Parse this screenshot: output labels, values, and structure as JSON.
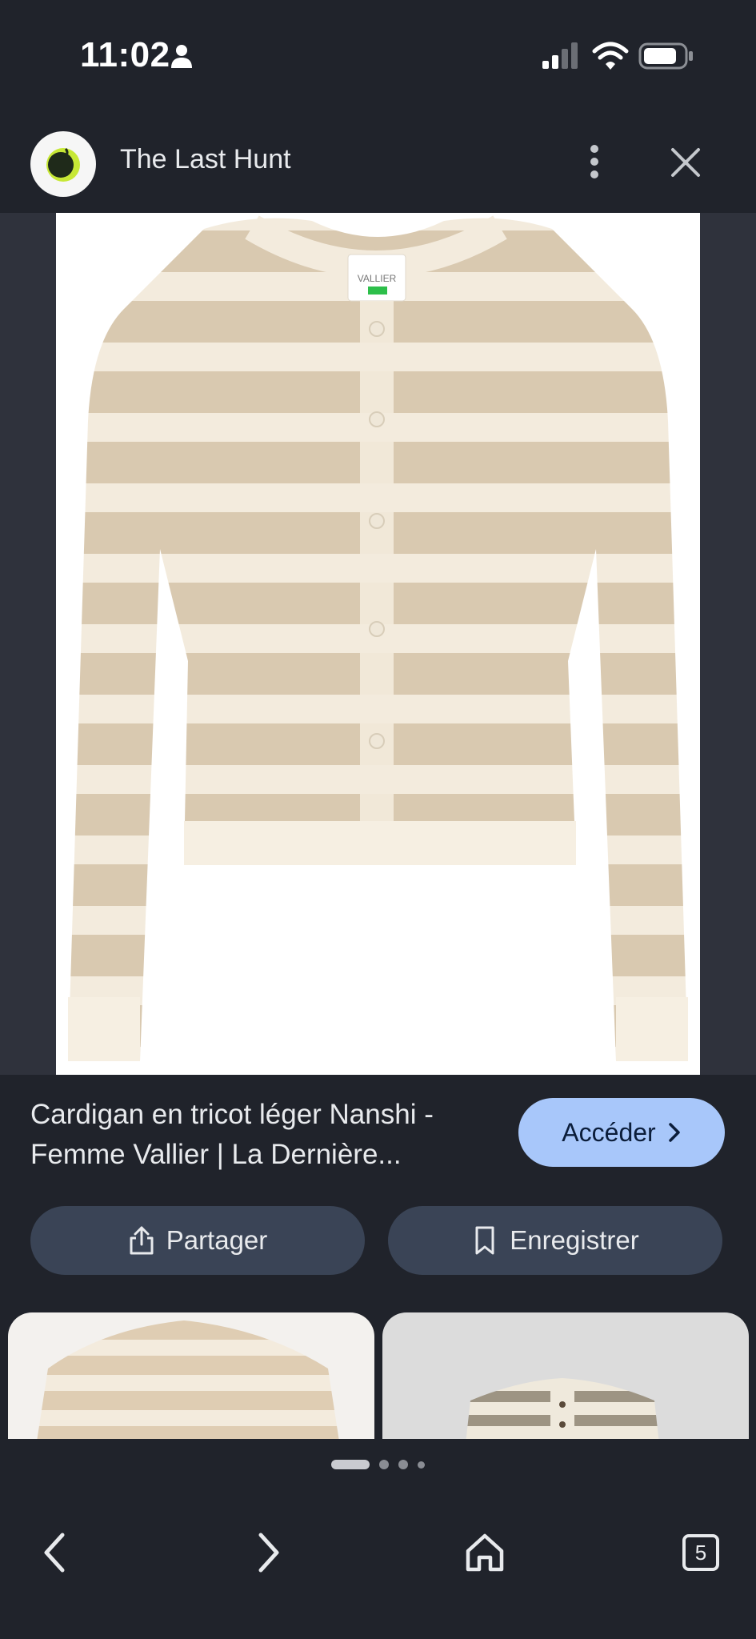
{
  "status_bar": {
    "time": "11:02",
    "icons": [
      "person-icon",
      "signal-icon",
      "wifi-icon",
      "battery-icon"
    ]
  },
  "header": {
    "site_name": "The Last Hunt",
    "logo_icon": "site-logo-icon",
    "menu_icon": "more-vert-icon",
    "close_icon": "close-icon"
  },
  "product": {
    "image_icon": "product-image",
    "title": "Cardigan en tricot léger Nanshi - Femme Vallier | La Dernière...",
    "visit_label": "Accéder",
    "label_text": "VALLIER"
  },
  "actions": {
    "share_label": "Partager",
    "save_label": "Enregistrer"
  },
  "pagination": {
    "current": 1,
    "total": 4
  },
  "bottom_nav": {
    "tabs_count": "5",
    "icons": [
      "back-icon",
      "forward-icon",
      "home-icon",
      "tabs-icon"
    ]
  },
  "colors": {
    "background": "#20232b",
    "accent_button": "#a8c7fa",
    "secondary_button": "#3a4456"
  }
}
